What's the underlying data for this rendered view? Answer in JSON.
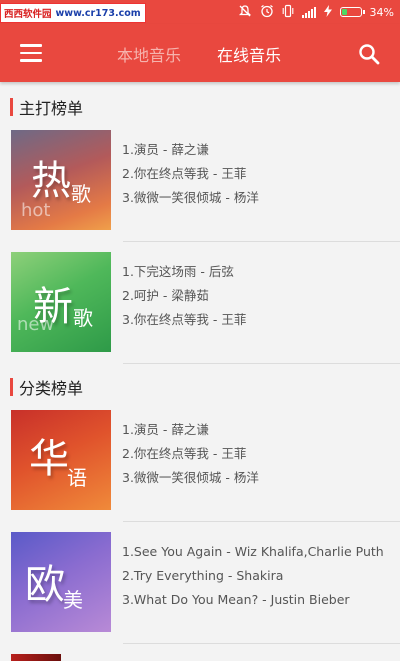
{
  "status_bar": {
    "watermark_cn": "西西软件园",
    "watermark_url": "www.cr173.com",
    "battery": "34%",
    "battery_level": 0.34,
    "icons": [
      "mute-icon",
      "alarm-icon",
      "vibrate-icon",
      "signal-icon",
      "charging-icon",
      "battery-icon"
    ]
  },
  "toolbar": {
    "menu_icon": "hamburger-menu-icon",
    "tabs": [
      {
        "label": "本地音乐",
        "active": false
      },
      {
        "label": "在线音乐",
        "active": true
      }
    ],
    "search_icon": "search-icon"
  },
  "sections": [
    {
      "title": "主打榜单",
      "charts": [
        {
          "cover": {
            "big": "热",
            "small": "歌",
            "latin": "hot"
          },
          "songs": [
            "1.演员 - 薛之谦",
            "2.你在终点等我 - 王菲",
            "3.微微一笑很倾城 - 杨洋"
          ]
        },
        {
          "cover": {
            "big": "新",
            "small": "歌",
            "latin": "new"
          },
          "songs": [
            "1.下完这场雨 - 后弦",
            "2.呵护 - 梁静茹",
            "3.你在终点等我 - 王菲"
          ]
        }
      ]
    },
    {
      "title": "分类榜单",
      "charts": [
        {
          "cover": {
            "big": "华",
            "small": "语",
            "latin": ""
          },
          "songs": [
            "1.演员 - 薛之谦",
            "2.你在终点等我 - 王菲",
            "3.微微一笑很倾城 - 杨洋"
          ]
        },
        {
          "cover": {
            "big": "欧",
            "small": "美",
            "latin": ""
          },
          "songs": [
            "1.See You Again - Wiz Khalifa,Charlie Puth",
            "2.Try Everything - Shakira",
            "3.What Do You Mean? - Justin Bieber"
          ]
        }
      ]
    }
  ],
  "colors": {
    "accent": "#e9483f",
    "tab_inactive": "#f6b3ad",
    "background": "#f3f3f3"
  }
}
